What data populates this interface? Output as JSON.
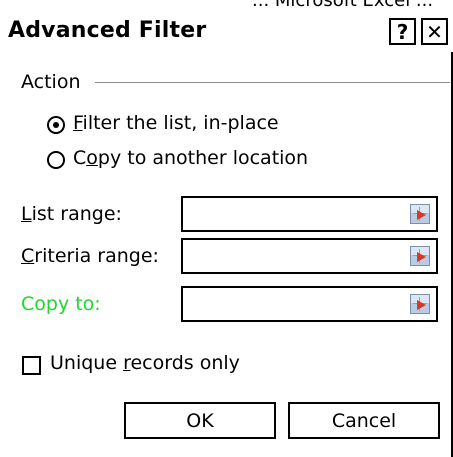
{
  "window": {
    "title": "Advanced Filter",
    "help_label": "?",
    "close_label": "✕"
  },
  "cropped_text": "... Microsoft Excel ...",
  "action_group": {
    "label": "Action",
    "options": [
      {
        "pre": "",
        "mnemonic": "F",
        "post": "ilter the list, in-place",
        "selected": true
      },
      {
        "pre": "C",
        "mnemonic": "o",
        "post": "py to another location",
        "selected": false
      }
    ]
  },
  "fields": [
    {
      "mnemonic": "L",
      "rest": "ist range:",
      "value": "",
      "label_color": "#000000"
    },
    {
      "mnemonic": "C",
      "rest": "riteria range:",
      "value": "",
      "label_color": "#000000"
    },
    {
      "mnemonic": "",
      "rest": "Copy to:",
      "value": "",
      "label_color": "#1ed82c"
    }
  ],
  "unique_records": {
    "pre": "Unique ",
    "mnemonic": "r",
    "post": "ecords only",
    "checked": false
  },
  "buttons": {
    "ok": "OK",
    "cancel": "Cancel"
  },
  "icons": {
    "range_picker": "collapse-dialog-icon"
  }
}
